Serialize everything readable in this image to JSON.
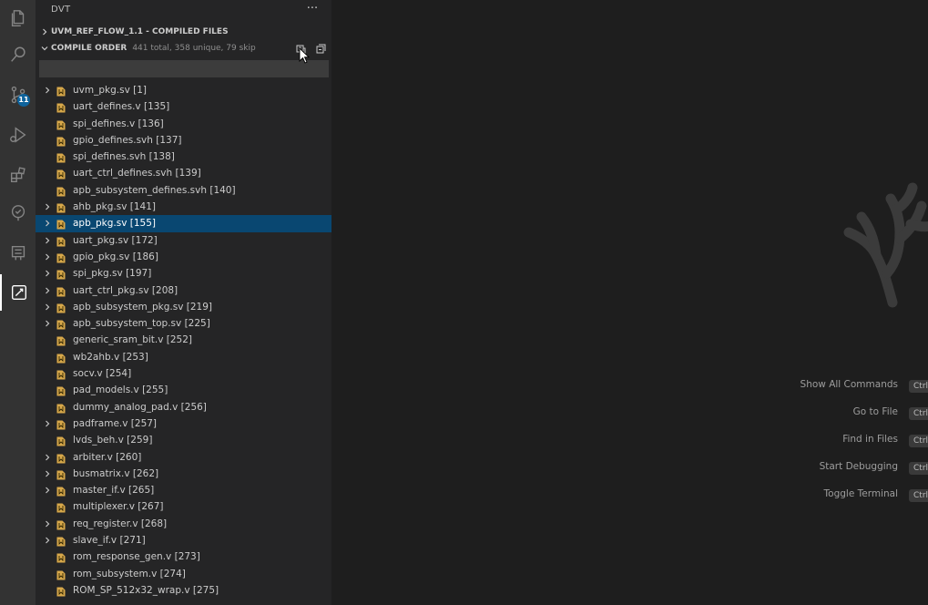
{
  "sidebar": {
    "title": "DVT",
    "more_label": "···"
  },
  "activity_bar": {
    "source_control_badge": "11"
  },
  "sections": {
    "compiled_files": {
      "title": "UVM_REF_FLOW_1.1 - COMPILED FILES"
    },
    "compile_order": {
      "title": "COMPILE ORDER",
      "description": "441 total, 358 unique, 79 skip"
    }
  },
  "filter": {
    "value": ""
  },
  "tree": [
    {
      "label": "uvm_pkg.sv [1]",
      "expandable": true
    },
    {
      "label": "uart_defines.v [135]",
      "expandable": false
    },
    {
      "label": "spi_defines.v [136]",
      "expandable": false
    },
    {
      "label": "gpio_defines.svh [137]",
      "expandable": false
    },
    {
      "label": "spi_defines.svh [138]",
      "expandable": false
    },
    {
      "label": "uart_ctrl_defines.svh [139]",
      "expandable": false
    },
    {
      "label": "apb_subsystem_defines.svh [140]",
      "expandable": false
    },
    {
      "label": "ahb_pkg.sv [141]",
      "expandable": true
    },
    {
      "label": "apb_pkg.sv [155]",
      "expandable": true,
      "selected": true
    },
    {
      "label": "uart_pkg.sv [172]",
      "expandable": true
    },
    {
      "label": "gpio_pkg.sv [186]",
      "expandable": true
    },
    {
      "label": "spi_pkg.sv [197]",
      "expandable": true
    },
    {
      "label": "uart_ctrl_pkg.sv [208]",
      "expandable": true
    },
    {
      "label": "apb_subsystem_pkg.sv [219]",
      "expandable": true
    },
    {
      "label": "apb_subsystem_top.sv [225]",
      "expandable": true
    },
    {
      "label": "generic_sram_bit.v [252]",
      "expandable": false
    },
    {
      "label": "wb2ahb.v [253]",
      "expandable": false
    },
    {
      "label": "socv.v [254]",
      "expandable": false
    },
    {
      "label": "pad_models.v [255]",
      "expandable": false
    },
    {
      "label": "dummy_analog_pad.v [256]",
      "expandable": false
    },
    {
      "label": "padframe.v [257]",
      "expandable": true
    },
    {
      "label": "lvds_beh.v [259]",
      "expandable": false
    },
    {
      "label": "arbiter.v [260]",
      "expandable": true
    },
    {
      "label": "busmatrix.v [262]",
      "expandable": true
    },
    {
      "label": "master_if.v [265]",
      "expandable": true
    },
    {
      "label": "multiplexer.v [267]",
      "expandable": false
    },
    {
      "label": "req_register.v [268]",
      "expandable": true
    },
    {
      "label": "slave_if.v [271]",
      "expandable": true
    },
    {
      "label": "rom_response_gen.v [273]",
      "expandable": false
    },
    {
      "label": "rom_subsystem.v [274]",
      "expandable": false
    },
    {
      "label": "ROM_SP_512x32_wrap.v [275]",
      "expandable": false
    }
  ],
  "shortcuts": [
    {
      "label": "Show All Commands",
      "key": "Ctrl"
    },
    {
      "label": "Go to File",
      "key": "Ctrl"
    },
    {
      "label": "Find in Files",
      "key": "Ctrl"
    },
    {
      "label": "Start Debugging",
      "key": "Ctrl"
    },
    {
      "label": "Toggle Terminal",
      "key": "Ctrl"
    }
  ],
  "colors": {
    "selection": "#094771",
    "badge": "#0e639c",
    "file_icon": "#d7a84a"
  }
}
